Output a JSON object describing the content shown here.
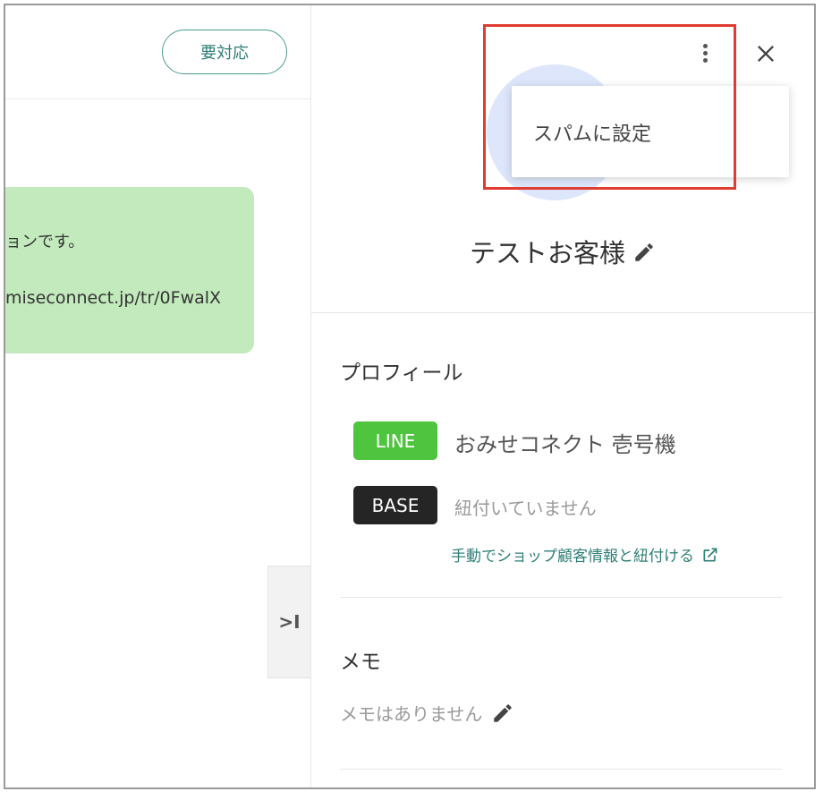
{
  "header": {
    "status_button": "要対応"
  },
  "chat": {
    "message_line1": "ョンです。",
    "message_line2": "miseconnect.jp/tr/0FwalX",
    "collapse_label": ">I"
  },
  "panel": {
    "menu": {
      "items": [
        "スパムに設定"
      ]
    },
    "customer_name": "テストお客様",
    "profile": {
      "title": "プロフィール",
      "line_badge": "LINE",
      "line_account": "おみせコネクト 壱号機",
      "base_badge": "BASE",
      "base_status": "紐付いていません",
      "link_label": "手動でショップ顧客情報と紐付ける"
    },
    "memo": {
      "title": "メモ",
      "empty_text": "メモはありません"
    }
  },
  "colors": {
    "accent": "#2f7f77",
    "line_green": "#4fc43f",
    "bubble": "#c3eabd",
    "highlight": "#e03c31",
    "avatar": "#dde6fb"
  },
  "icons": [
    "more-vert-icon",
    "close-icon",
    "pencil-icon",
    "external-link-icon"
  ]
}
